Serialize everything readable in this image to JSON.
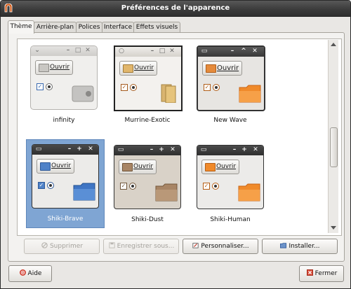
{
  "window": {
    "title": "Préférences de l'apparence"
  },
  "tabs": [
    {
      "label": "Thème",
      "active": true
    },
    {
      "label": "Arrière-plan",
      "active": false
    },
    {
      "label": "Polices",
      "active": false
    },
    {
      "label": "Interface",
      "active": false
    },
    {
      "label": "Effets visuels",
      "active": false
    }
  ],
  "preview": {
    "button_label": "Ouvrir"
  },
  "themes": [
    {
      "name": "infinity",
      "selected": false
    },
    {
      "name": "Murrine-Exotic",
      "selected": false
    },
    {
      "name": "New Wave",
      "selected": false
    },
    {
      "name": "Shiki-Brave",
      "selected": true
    },
    {
      "name": "Shiki-Dust",
      "selected": false
    },
    {
      "name": "Shiki-Human",
      "selected": false
    }
  ],
  "actions": {
    "delete_label": "Supprimer",
    "save_as_label": "Enregistrer sous...",
    "customize_label": "Personnaliser...",
    "install_label": "Installer..."
  },
  "footer": {
    "help_label": "Aide",
    "close_label": "Fermer"
  },
  "colors": {
    "selection": "#7fa5d3",
    "titlebar": "#3c3c3c",
    "orange_folder": "#f08a2a",
    "blue_folder": "#3f75c4",
    "tan_folder": "#a88565"
  }
}
